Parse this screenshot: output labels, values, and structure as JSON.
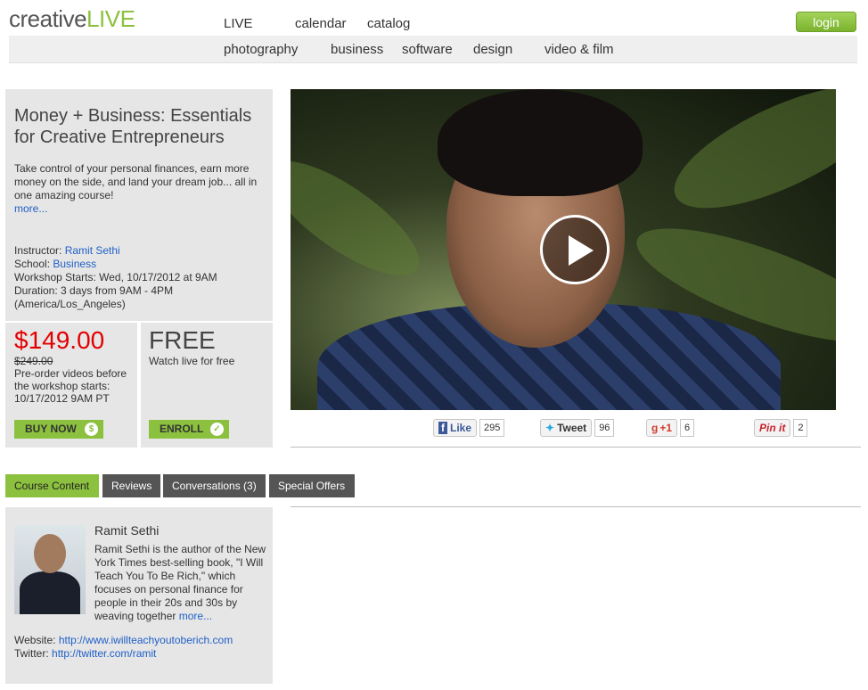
{
  "header": {
    "logo_part1": "creative",
    "logo_part2": "LIVE",
    "nav": [
      "LIVE",
      "calendar",
      "catalog"
    ],
    "login": "login",
    "categories": [
      "photography",
      "business",
      "software",
      "design",
      "video & film"
    ]
  },
  "course": {
    "title": "Money + Business: Essentials for Creative Entrepreneurs",
    "description": "Take control of your personal finances, earn more money on the side, and land your dream job... all in one amazing course!",
    "more": "more...",
    "instructor_label": "Instructor:",
    "instructor": "Ramit Sethi",
    "school_label": "School:",
    "school": "Business",
    "starts": "Workshop Starts: Wed, 10/17/2012 at 9AM",
    "duration": "Duration: 3 days from 9AM - 4PM (America/Los_Angeles)"
  },
  "pricing": {
    "price": "$149.00",
    "old_price": "$249.00",
    "preorder_text": "Pre-order videos before the workshop starts: 10/17/2012 9AM PT",
    "buy_label": "BUY NOW",
    "buy_icon": "$",
    "free": "FREE",
    "free_text": "Watch live for free",
    "enroll_label": "ENROLL",
    "enroll_icon": "✓"
  },
  "social": {
    "like_label": "Like",
    "like_count": "295",
    "tweet_label": "Tweet",
    "tweet_count": "96",
    "plus_label": "+1",
    "plus_count": "6",
    "pin_label": "Pin it",
    "pin_count": "2"
  },
  "tabs": [
    "Course Content",
    "Reviews",
    "Conversations (3)",
    "Special Offers"
  ],
  "instructor_card": {
    "name": "Ramit Sethi",
    "bio": "Ramit Sethi is the author of the New York Times best-selling book, \"I Will Teach You To Be Rich,\" which focuses on personal finance for people in their 20s and 30s by weaving together",
    "more": "more...",
    "website_label": "Website:",
    "website": "http://www.iwillteachyoutoberich.com",
    "twitter_label": "Twitter:",
    "twitter": "http://twitter.com/ramit"
  },
  "colors": {
    "brand_green": "#8cc13f",
    "price_red": "#e30000",
    "tab_dark": "#555555",
    "link_blue": "#1f5fc7"
  }
}
